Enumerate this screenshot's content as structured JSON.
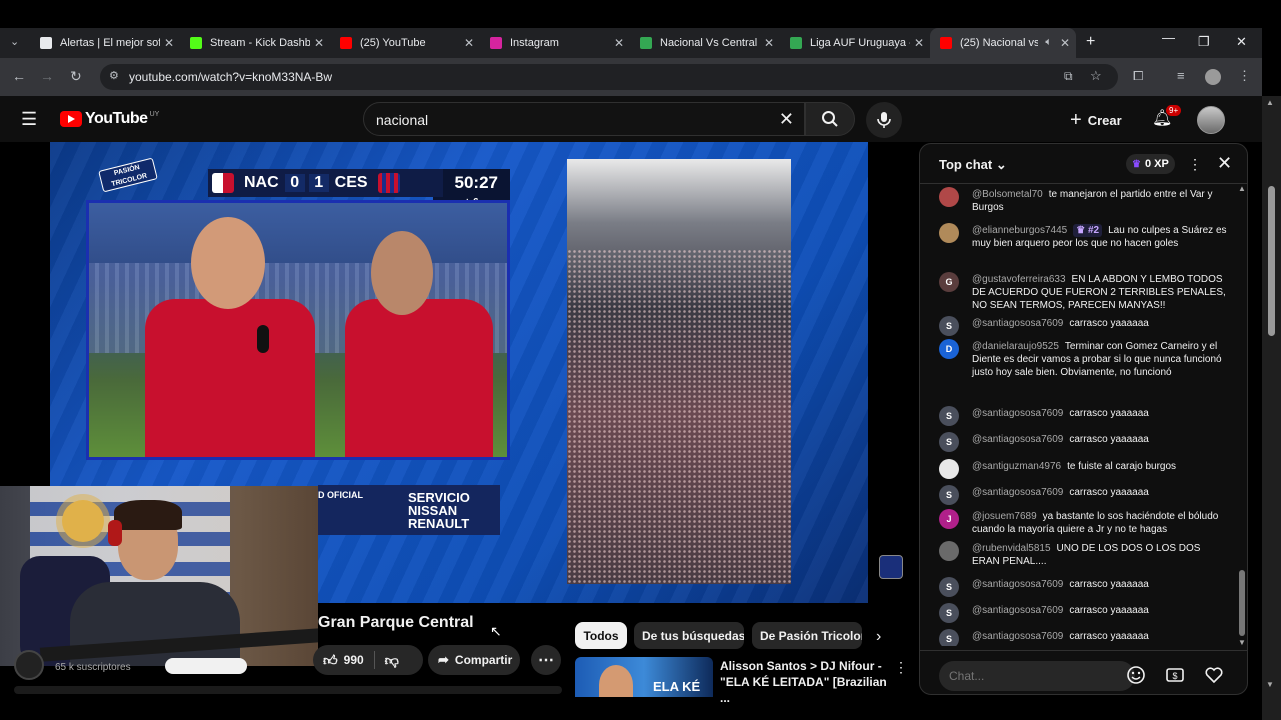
{
  "browser": {
    "tabs": [
      {
        "title": "Alertas | El mejor sof",
        "favicon_color": "#e8eaed"
      },
      {
        "title": "Stream - Kick Dashbo",
        "favicon_color": "#53fc18"
      },
      {
        "title": "(25) YouTube",
        "favicon_color": "#ff0000"
      },
      {
        "title": "Instagram",
        "favicon_color": "#d6249f"
      },
      {
        "title": "Nacional Vs Central E",
        "favicon_color": "#34a853"
      },
      {
        "title": "Liga AUF Uruguaya -",
        "favicon_color": "#34a853"
      },
      {
        "title": "(25) Nacional vs C",
        "favicon_color": "#ff0000"
      }
    ],
    "url": "youtube.com/watch?v=knoM33NA-Bw"
  },
  "youtube": {
    "logo_text": "YouTube",
    "country_code": "UY",
    "search_value": "nacional",
    "create_label": "Crear",
    "notifications_badge": "9+"
  },
  "video": {
    "scoreboard": {
      "home": "NAC",
      "home_score": "0",
      "away_score": "1",
      "away": "CES",
      "clock": "50:27",
      "added_time": "+ 6"
    },
    "logo_text": "PASIÓN TRICOLOR",
    "sponsor_small": "D OFICIAL",
    "sponsor_big": "SERVICIO NISSAN RENAULT",
    "thumb_text": "ELA KÉ"
  },
  "below_video": {
    "title": "Gran Parque Central",
    "subscribers": "65 k suscriptores",
    "likes": "990",
    "share_label": "Compartir"
  },
  "chips": [
    "Todos",
    "De tus búsquedas",
    "De Pasión Tricolor"
  ],
  "recommendation": {
    "title": "Alisson Santos > DJ Nifour - \"ELA KÉ LEITADA\" [Brazilian ..."
  },
  "chat": {
    "mode": "Top chat",
    "xp": "0 XP",
    "input_placeholder": "Chat...",
    "messages": [
      {
        "author": "@Bolsometal70",
        "text": "te manejaron el partido entre el Var y Burgos",
        "avatar": "",
        "avatar_color": "#b04848"
      },
      {
        "author": "@elianneburgos7445",
        "badge": "♛ #2",
        "text": "Lau no culpes a Suárez es muy bien arquero peor los que no hacen goles",
        "avatar": "",
        "avatar_color": "#b08a5a"
      },
      {
        "author": "@gustavoferreira633",
        "text": "EN LA ABDON Y LEMBO TODOS DE ACUERDO QUE FUERON 2 TERRIBLES PENALES, NO SEAN TERMOS, PARECEN MANYAS!!",
        "avatar": "G",
        "avatar_color": "#5a3d3d"
      },
      {
        "author": "@santiagososa7609",
        "text": "carrasco yaaaaaa",
        "avatar": "S",
        "avatar_color": "#4a4f5c"
      },
      {
        "author": "@danielaraujo9525",
        "text": "Terminar con Gomez Carneiro y el Diente es decir vamos a probar si lo que nunca funcionó justo hoy sale bien. Obviamente, no funcionó",
        "avatar": "D",
        "avatar_color": "#1a63d6"
      },
      {
        "author": "@santiagososa7609",
        "text": "carrasco yaaaaaa",
        "avatar": "S",
        "avatar_color": "#4a4f5c"
      },
      {
        "author": "@santiagososa7609",
        "text": "carrasco yaaaaaa",
        "avatar": "S",
        "avatar_color": "#4a4f5c"
      },
      {
        "author": "@santiguzman4976",
        "text": "te fuiste al carajo burgos",
        "avatar": "",
        "avatar_color": "#e8e8e8"
      },
      {
        "author": "@santiagososa7609",
        "text": "carrasco yaaaaaa",
        "avatar": "S",
        "avatar_color": "#4a4f5c"
      },
      {
        "author": "@josuem7689",
        "text": "ya bastante lo sos haciéndote el bóludo cuando la mayoría quiere a Jr y no te hagas",
        "avatar": "J",
        "avatar_color": "#b0208a"
      },
      {
        "author": "@rubenvidal5815",
        "text": "UNO DE LOS DOS O LOS DOS ERAN PENAL....",
        "avatar": "",
        "avatar_color": "#6a6a6a"
      },
      {
        "author": "@santiagososa7609",
        "text": "carrasco yaaaaaa",
        "avatar": "S",
        "avatar_color": "#4a4f5c"
      },
      {
        "author": "@santiagososa7609",
        "text": "carrasco yaaaaaa",
        "avatar": "S",
        "avatar_color": "#4a4f5c"
      },
      {
        "author": "@santiagososa7609",
        "text": "carrasco yaaaaaa",
        "avatar": "S",
        "avatar_color": "#4a4f5c"
      }
    ]
  }
}
